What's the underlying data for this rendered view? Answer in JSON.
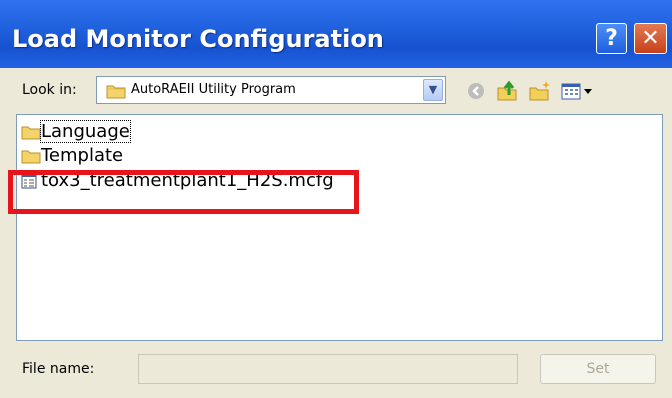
{
  "window": {
    "title": "Load Monitor Configuration",
    "help_label": "?",
    "close_label": "✕"
  },
  "toolbar": {
    "look_in_label": "Look in:",
    "look_in_value": "AutoRAEII Utility Program",
    "icons": [
      "back-icon",
      "up-folder-icon",
      "new-folder-icon",
      "view-menu-icon"
    ]
  },
  "files": [
    {
      "name": "Language",
      "type": "folder"
    },
    {
      "name": "Template",
      "type": "folder"
    },
    {
      "name": "tox3_treatmentplant1_H2S.mcfg",
      "type": "file"
    }
  ],
  "footer": {
    "file_name_label": "File name:",
    "file_name_value": "",
    "set_label": "Set"
  },
  "colors": {
    "titlebar": "#1f5fdc",
    "client": "#ece9d8",
    "highlight": "#e8141b"
  }
}
